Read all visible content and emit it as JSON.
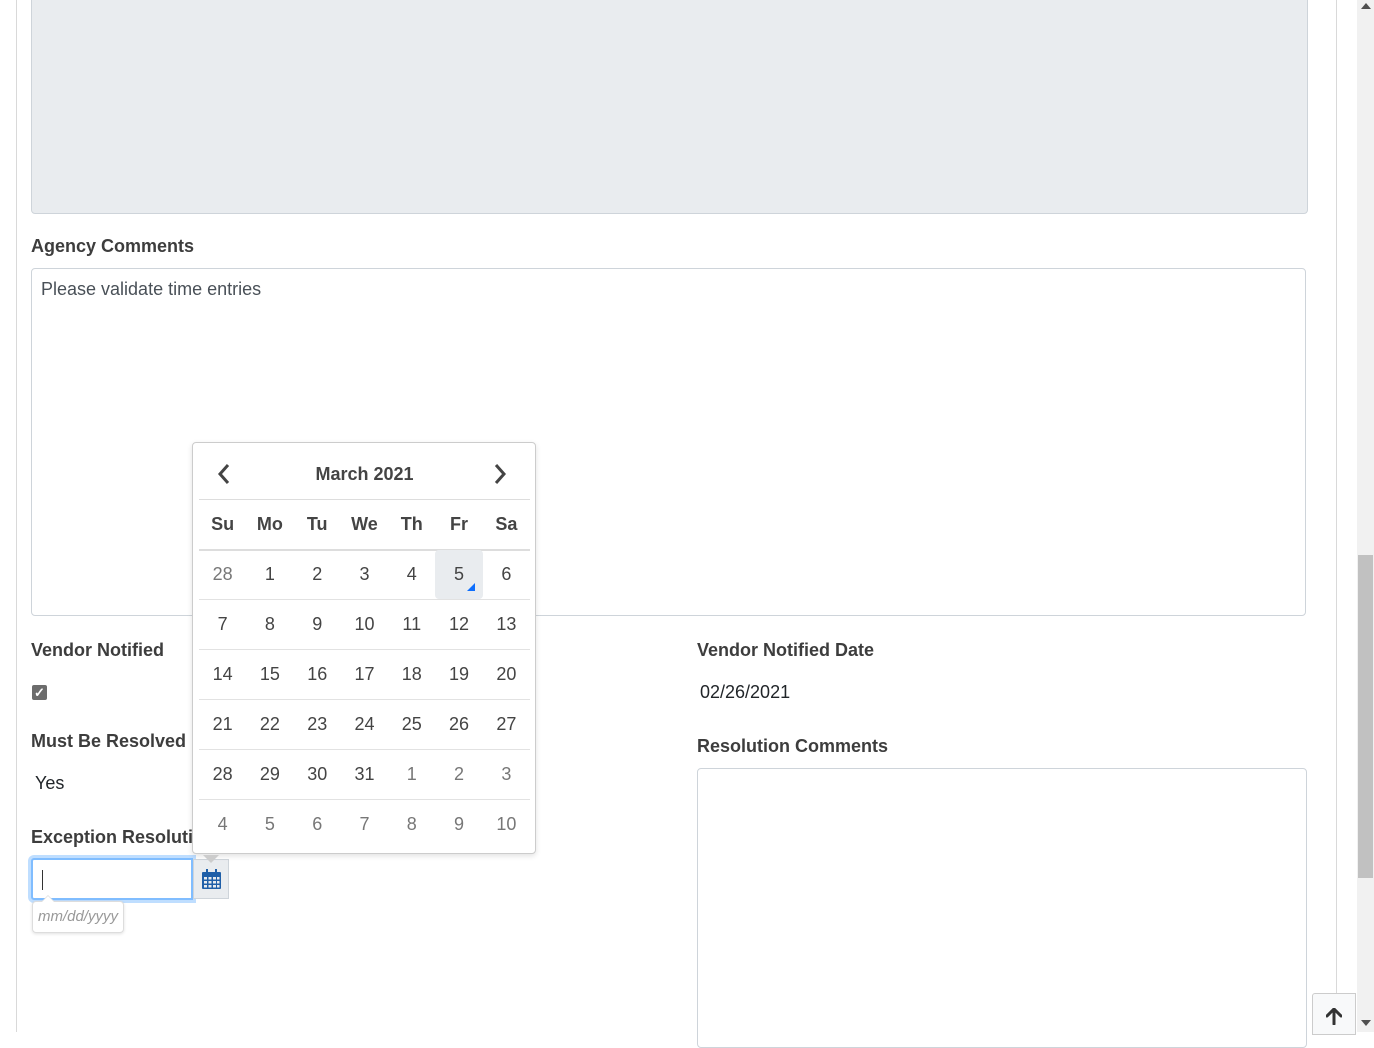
{
  "form": {
    "agency_comments_label": "Agency Comments",
    "agency_comments_value": "Please validate time entries",
    "vendor_notified_label": "Vendor Notified",
    "vendor_notified_checked": true,
    "vendor_notified_date_label": "Vendor Notified Date",
    "vendor_notified_date_value": "02/26/2021",
    "must_be_resolved_label": "Must Be Resolved",
    "must_be_resolved_value": "Yes",
    "resolution_comments_label": "Resolution Comments",
    "exception_resolution_label": "Exception Resolution Date",
    "exception_resolution_placeholder": "mm/dd/yyyy"
  },
  "datepicker": {
    "title": "March 2021",
    "weekdays": [
      "Su",
      "Mo",
      "Tu",
      "We",
      "Th",
      "Fr",
      "Sa"
    ],
    "weeks": [
      [
        {
          "d": "28",
          "other": true
        },
        {
          "d": "1"
        },
        {
          "d": "2"
        },
        {
          "d": "3"
        },
        {
          "d": "4"
        },
        {
          "d": "5",
          "today": true
        },
        {
          "d": "6"
        }
      ],
      [
        {
          "d": "7"
        },
        {
          "d": "8"
        },
        {
          "d": "9"
        },
        {
          "d": "10"
        },
        {
          "d": "11"
        },
        {
          "d": "12"
        },
        {
          "d": "13"
        }
      ],
      [
        {
          "d": "14"
        },
        {
          "d": "15"
        },
        {
          "d": "16"
        },
        {
          "d": "17"
        },
        {
          "d": "18"
        },
        {
          "d": "19"
        },
        {
          "d": "20"
        }
      ],
      [
        {
          "d": "21"
        },
        {
          "d": "22"
        },
        {
          "d": "23"
        },
        {
          "d": "24"
        },
        {
          "d": "25"
        },
        {
          "d": "26"
        },
        {
          "d": "27"
        }
      ],
      [
        {
          "d": "28"
        },
        {
          "d": "29"
        },
        {
          "d": "30"
        },
        {
          "d": "31"
        },
        {
          "d": "1",
          "other": true
        },
        {
          "d": "2",
          "other": true
        },
        {
          "d": "3",
          "other": true
        }
      ],
      [
        {
          "d": "4",
          "other": true
        },
        {
          "d": "5",
          "other": true
        },
        {
          "d": "6",
          "other": true
        },
        {
          "d": "7",
          "other": true
        },
        {
          "d": "8",
          "other": true
        },
        {
          "d": "9",
          "other": true
        },
        {
          "d": "10",
          "other": true
        }
      ]
    ]
  },
  "icons": {
    "prev": "chevron-left-icon",
    "next": "chevron-right-icon",
    "calendar": "calendar-icon",
    "back_to_top": "arrow-up-icon"
  },
  "colors": {
    "focus_border": "#80bdff",
    "calendar_icon": "#1f5fa8",
    "today_marker": "#0d6efd"
  }
}
